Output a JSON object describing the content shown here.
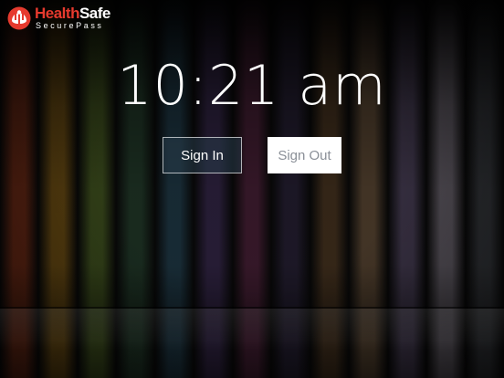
{
  "app": {
    "logo_name_red": "Health",
    "logo_name_white": "Safe",
    "logo_sub": "SecurePass",
    "logo_icon": "hands-heart-icon"
  },
  "clock": {
    "time": "10:21 am"
  },
  "actions": {
    "sign_in_label": "Sign In",
    "sign_out_label": "Sign Out"
  },
  "colors": {
    "brand_red": "#e63a2e",
    "stripes": [
      "#5a2312",
      "#5b4110",
      "#36451a",
      "#1c2f22",
      "#1a2f3a",
      "#2a1f3a",
      "#3a1a2c",
      "#1f1a2a",
      "#3a2a1a",
      "#4a3a2a",
      "#3b3346",
      "#555058",
      "#2d2f33"
    ]
  }
}
